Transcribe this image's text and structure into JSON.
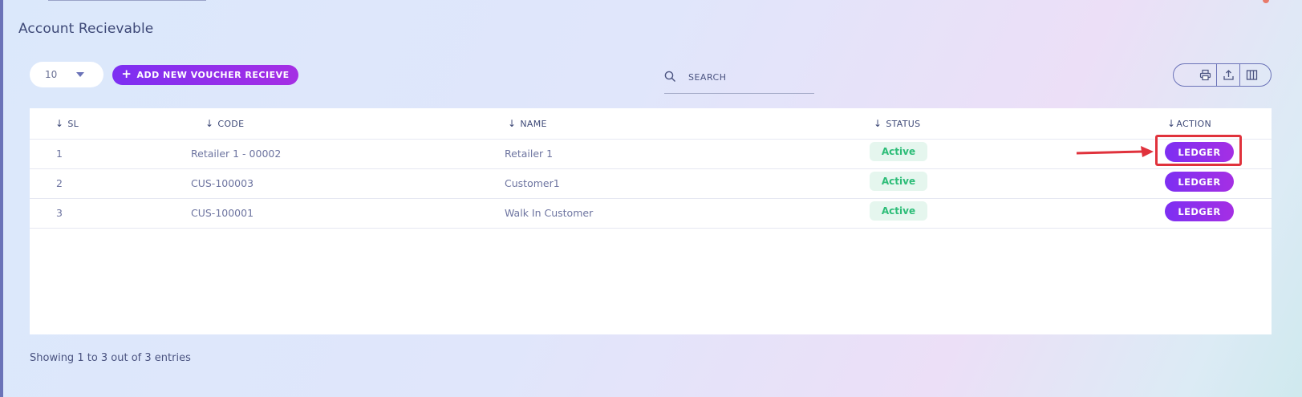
{
  "page": {
    "title": "Account Recievable"
  },
  "toolbar": {
    "page_size": "10",
    "add_button_label": "ADD NEW VOUCHER RECIEVE",
    "search_placeholder": "SEARCH",
    "tools": [
      "print-icon",
      "export-icon",
      "columns-icon"
    ]
  },
  "table": {
    "columns": [
      "SL",
      "CODE",
      "NAME",
      "STATUS",
      "ACTION"
    ],
    "rows": [
      {
        "sl": "1",
        "code": "Retailer 1 - 00002",
        "name": "Retailer 1",
        "status": "Active",
        "action": "LEDGER"
      },
      {
        "sl": "2",
        "code": "CUS-100003",
        "name": "Customer1",
        "status": "Active",
        "action": "LEDGER"
      },
      {
        "sl": "3",
        "code": "CUS-100001",
        "name": "Walk In Customer",
        "status": "Active",
        "action": "LEDGER"
      }
    ]
  },
  "footer": {
    "info": "Showing 1 to 3 out of 3 entries"
  },
  "colors": {
    "accent": "#8b2ff0",
    "status_active": "#2dbd78",
    "annotation": "#e0323c"
  }
}
